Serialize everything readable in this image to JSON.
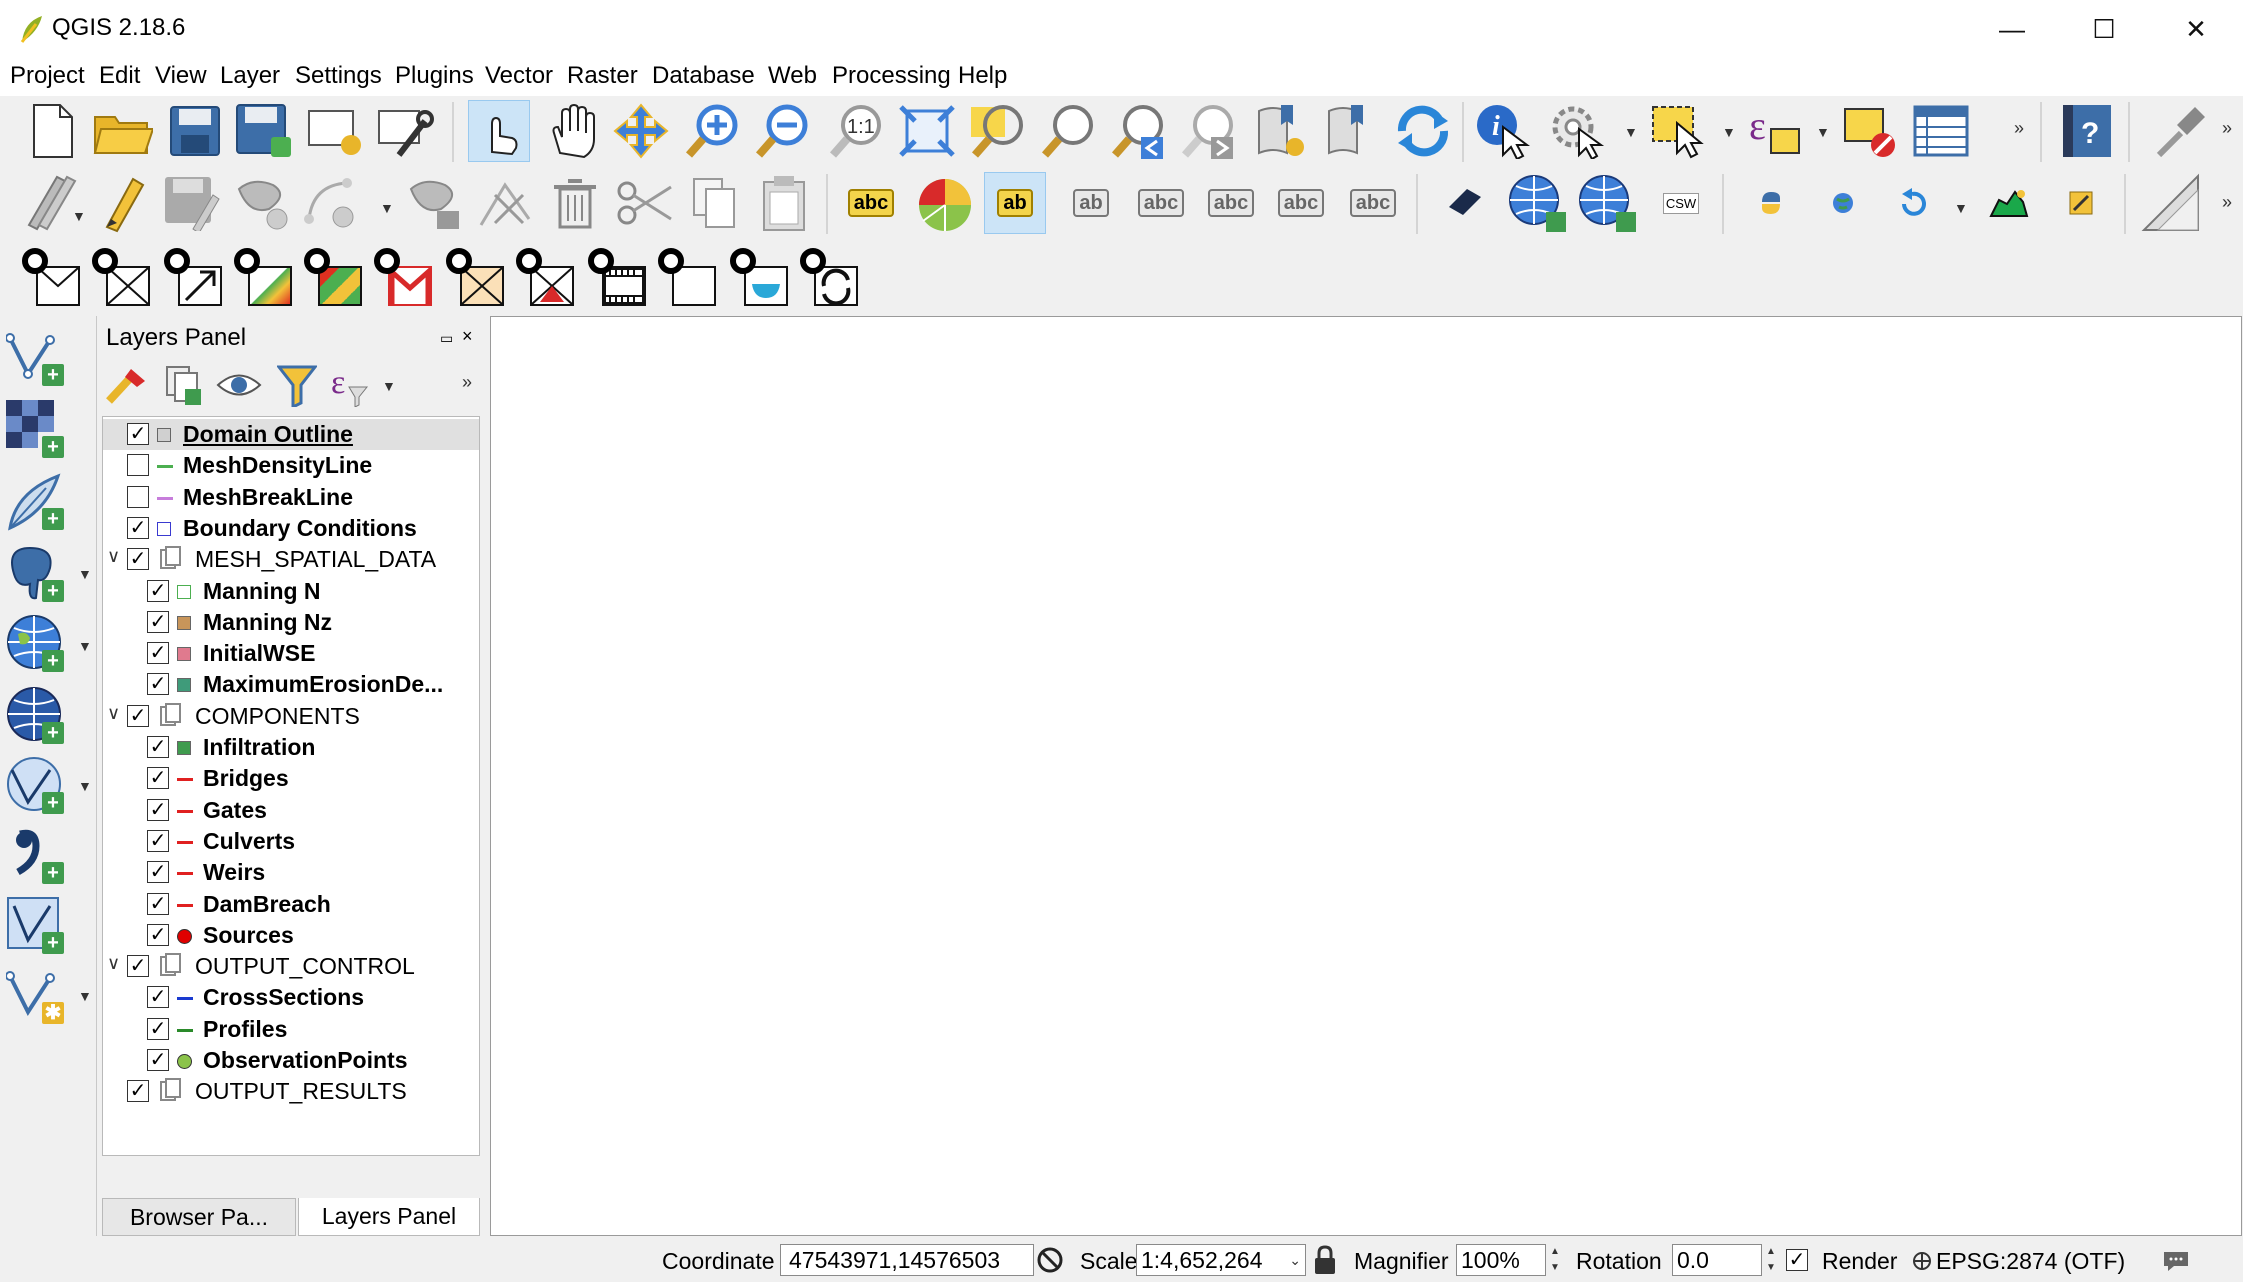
{
  "window": {
    "title": "QGIS 2.18.6"
  },
  "menu": [
    "Project",
    "Edit",
    "View",
    "Layer",
    "Settings",
    "Plugins",
    "Vector",
    "Raster",
    "Database",
    "Web",
    "Processing",
    "Help"
  ],
  "toolbar": {
    "label_abc": "abc",
    "label_ab": "ab",
    "csw": "CSW"
  },
  "layers_panel": {
    "title": "Layers Panel",
    "layers": [
      {
        "name": "Domain Outline",
        "checked": true,
        "bold": true,
        "underline": true,
        "level": 0,
        "symbol": "square",
        "color": "#d0d0d0",
        "selected": true
      },
      {
        "name": "MeshDensityLine",
        "checked": false,
        "bold": true,
        "level": 0,
        "symbol": "line",
        "color": "#4caf50"
      },
      {
        "name": "MeshBreakLine",
        "checked": false,
        "bold": true,
        "level": 0,
        "symbol": "line",
        "color": "#c77ddb"
      },
      {
        "name": "Boundary Conditions",
        "checked": true,
        "bold": true,
        "level": 0,
        "symbol": "square",
        "color": "#ffffff",
        "border": "#3a3ad0"
      },
      {
        "name": "MESH_SPATIAL_DATA",
        "checked": true,
        "bold": false,
        "level": 0,
        "group": true
      },
      {
        "name": "Manning N",
        "checked": true,
        "bold": true,
        "level": 1,
        "symbol": "square",
        "color": "#ffffff",
        "border": "#4caf50"
      },
      {
        "name": "Manning Nz",
        "checked": true,
        "bold": true,
        "level": 1,
        "symbol": "square",
        "color": "#c8955a"
      },
      {
        "name": "InitialWSE",
        "checked": true,
        "bold": true,
        "level": 1,
        "symbol": "square",
        "color": "#e07a8e"
      },
      {
        "name": "MaximumErosionDe...",
        "checked": true,
        "bold": true,
        "level": 1,
        "symbol": "square",
        "color": "#3f9b7a"
      },
      {
        "name": "COMPONENTS",
        "checked": true,
        "bold": false,
        "level": 0,
        "group": true
      },
      {
        "name": "Infiltration",
        "checked": true,
        "bold": true,
        "level": 1,
        "symbol": "square",
        "color": "#3f9b4e"
      },
      {
        "name": "Bridges",
        "checked": true,
        "bold": true,
        "level": 1,
        "symbol": "line",
        "color": "#e02020"
      },
      {
        "name": "Gates",
        "checked": true,
        "bold": true,
        "level": 1,
        "symbol": "line",
        "color": "#e02020"
      },
      {
        "name": "Culverts",
        "checked": true,
        "bold": true,
        "level": 1,
        "symbol": "line",
        "color": "#e02020"
      },
      {
        "name": "Weirs",
        "checked": true,
        "bold": true,
        "level": 1,
        "symbol": "line",
        "color": "#e02020"
      },
      {
        "name": "DamBreach",
        "checked": true,
        "bold": true,
        "level": 1,
        "symbol": "line",
        "color": "#e02020"
      },
      {
        "name": "Sources",
        "checked": true,
        "bold": true,
        "level": 1,
        "symbol": "dot",
        "color": "#e00000"
      },
      {
        "name": "OUTPUT_CONTROL",
        "checked": true,
        "bold": false,
        "level": 0,
        "group": true
      },
      {
        "name": "CrossSections",
        "checked": true,
        "bold": true,
        "level": 1,
        "symbol": "line",
        "color": "#1a3ad0"
      },
      {
        "name": "Profiles",
        "checked": true,
        "bold": true,
        "level": 1,
        "symbol": "line",
        "color": "#2a8a2a"
      },
      {
        "name": "ObservationPoints",
        "checked": true,
        "bold": true,
        "level": 1,
        "symbol": "dot",
        "color": "#8bc34a"
      },
      {
        "name": "OUTPUT_RESULTS",
        "checked": true,
        "bold": false,
        "level": 0,
        "group": true,
        "collapsed": true
      }
    ]
  },
  "tabs": {
    "browser": "Browser Pa...",
    "layers": "Layers Panel"
  },
  "status": {
    "coordinate_label": "Coordinate",
    "coordinate_value": "47543971,14576503",
    "scale_label": "Scale",
    "scale_value": "1:4,652,264",
    "magnifier_label": "Magnifier",
    "magnifier_value": "100%",
    "rotation_label": "Rotation",
    "rotation_value": "0.0",
    "render_label": "Render",
    "crs": "EPSG:2874 (OTF)"
  }
}
